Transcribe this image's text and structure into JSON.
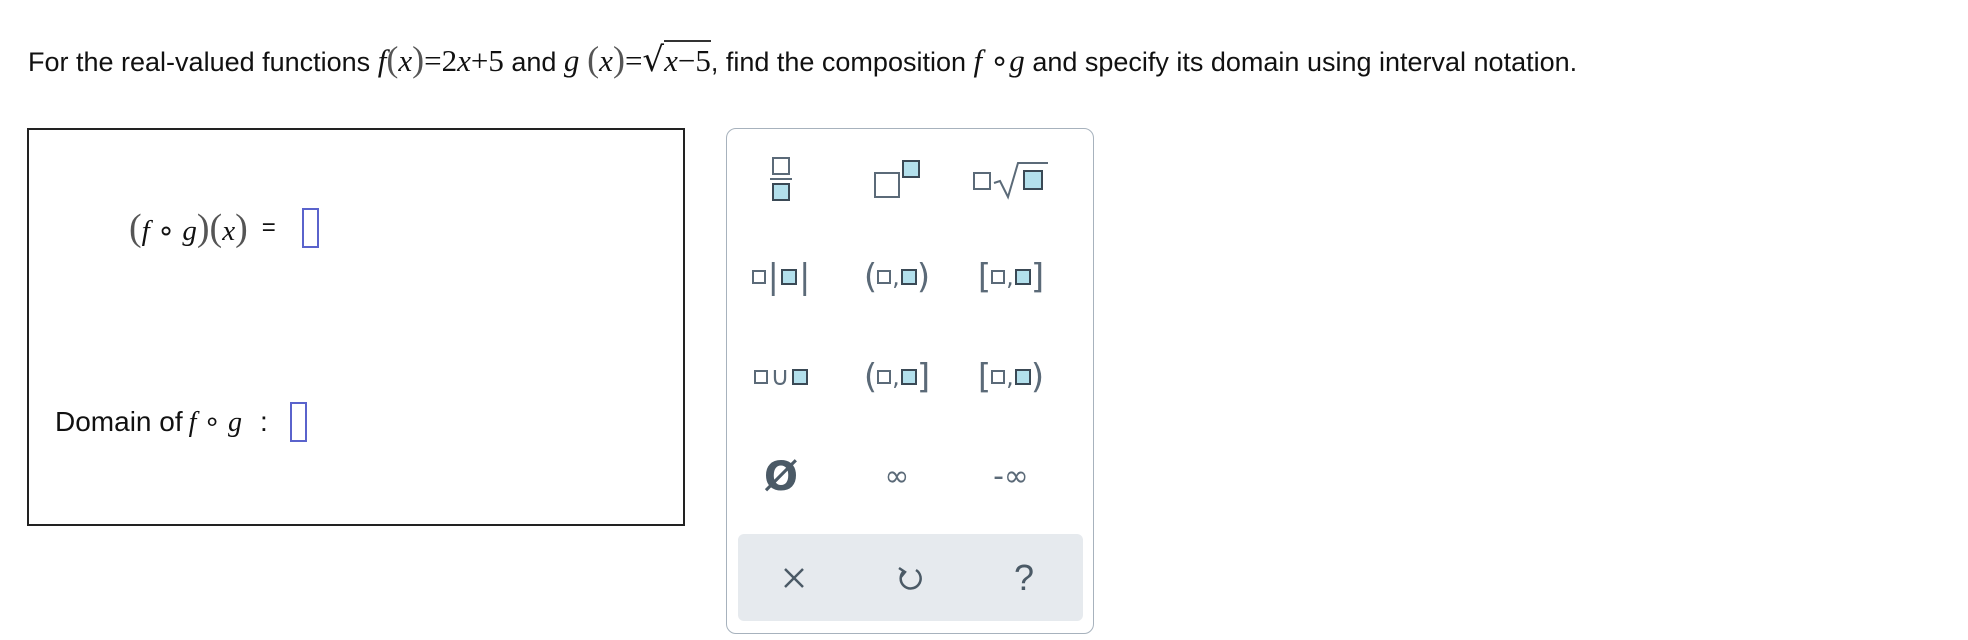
{
  "question": {
    "prefix": "For the real-valued functions",
    "f_def": "f(x) = 2x + 5",
    "and": "and",
    "g_def": "g(x) = √(x − 5)",
    "suffix_1": ", find the composition",
    "composition_symbol": "f ∘ g",
    "suffix_2": "and specify its domain using interval notation."
  },
  "answer": {
    "composition_label": "(f ∘ g)(x) =",
    "domain_prefix": "Domain of",
    "domain_symbol": "f ∘ g",
    "domain_colon": ":"
  },
  "palette": {
    "tools": [
      "fraction",
      "exponent",
      "nth-root",
      "absolute-value",
      "open-interval",
      "closed-interval",
      "union",
      "left-open-right-closed-interval",
      "left-closed-right-open-interval",
      "empty-set",
      "infinity",
      "negative-infinity"
    ],
    "infinity": "∞",
    "neg_infinity": "-∞",
    "empty_set": "Ø",
    "actions": {
      "clear": "×",
      "undo": "↺",
      "help": "?"
    }
  },
  "colors": {
    "input_border": "#5a63cc",
    "palette_border": "#a7b2bd",
    "action_bar": "#e6eaee",
    "box_fill": "#b3e0ec"
  }
}
